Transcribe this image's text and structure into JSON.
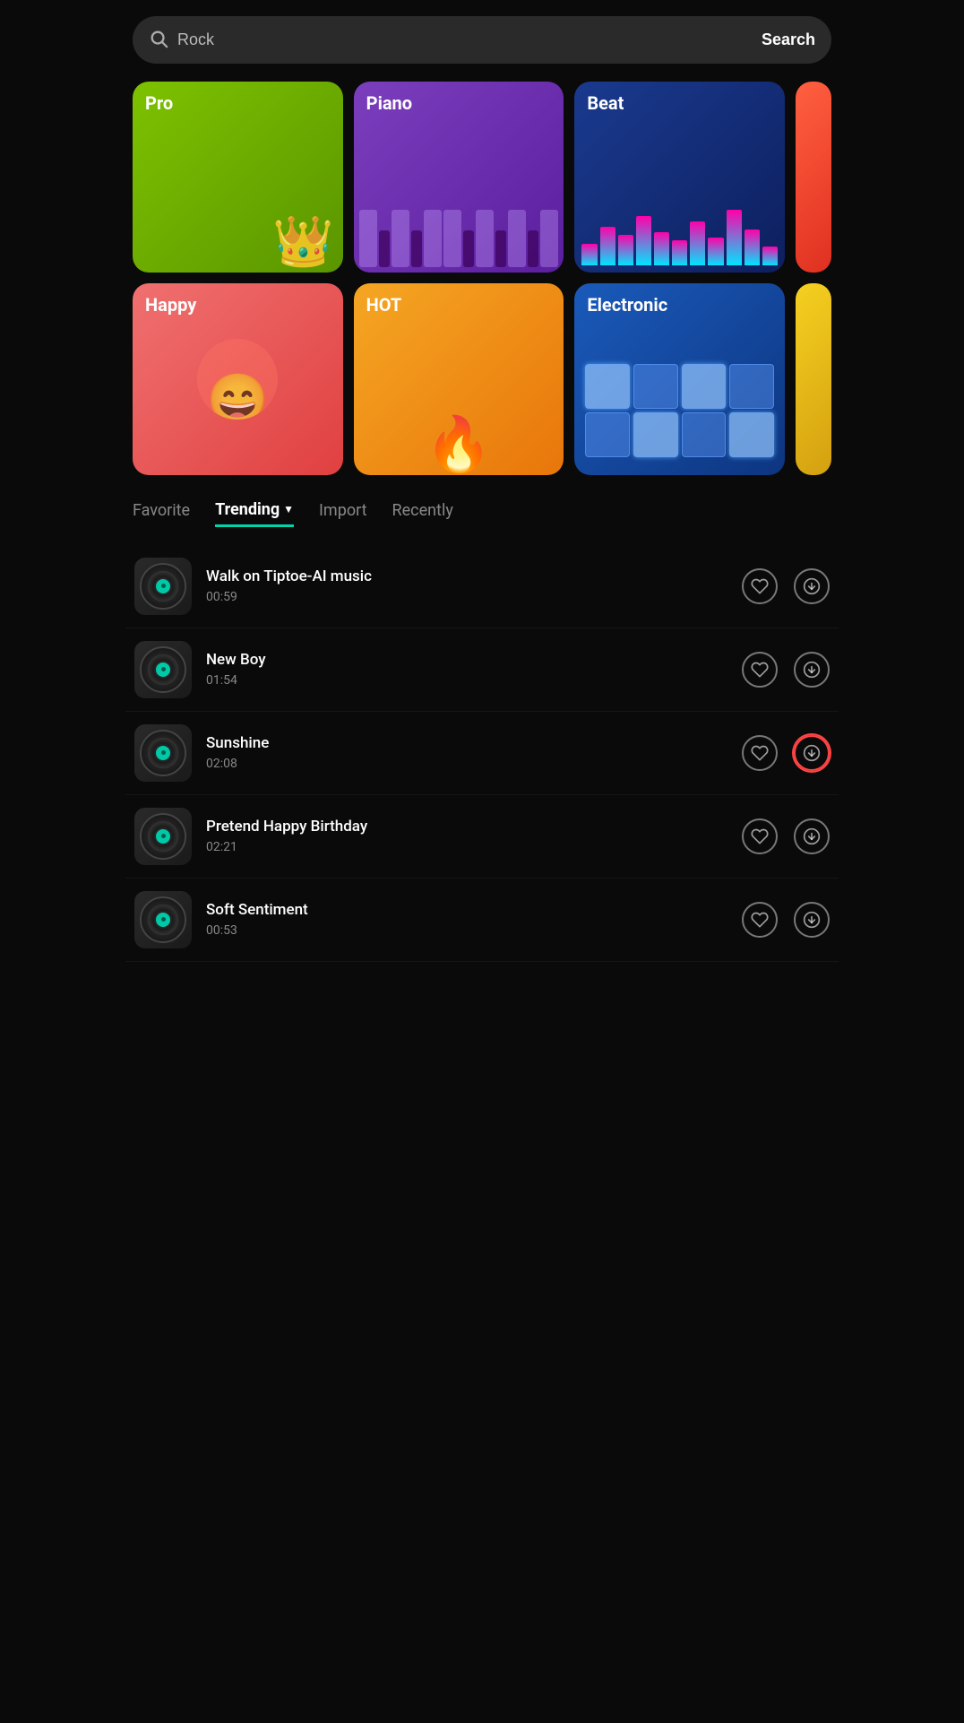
{
  "search": {
    "placeholder": "Rock",
    "button_label": "Search"
  },
  "categories": [
    {
      "id": "pro",
      "label": "Pro",
      "color_start": "#7dc200",
      "color_end": "#5a9500",
      "type": "pro"
    },
    {
      "id": "piano",
      "label": "Piano",
      "color_start": "#7b3fbe",
      "color_end": "#5a1e9e",
      "type": "piano"
    },
    {
      "id": "beat",
      "label": "Beat",
      "color_start": "#1a3a8f",
      "color_end": "#0d1f5e",
      "type": "beat"
    },
    {
      "id": "happy",
      "label": "Happy",
      "color_start": "#f07070",
      "color_end": "#e04040",
      "type": "happy"
    },
    {
      "id": "hot",
      "label": "HOT",
      "color_start": "#f5a623",
      "color_end": "#e8760a",
      "type": "hot"
    },
    {
      "id": "electronic",
      "label": "Electronic",
      "color_start": "#1a5aba",
      "color_end": "#0d3580",
      "type": "electronic"
    }
  ],
  "tabs": [
    {
      "id": "favorite",
      "label": "Favorite",
      "active": false
    },
    {
      "id": "trending",
      "label": "Trending",
      "active": true
    },
    {
      "id": "import",
      "label": "Import",
      "active": false
    },
    {
      "id": "recently",
      "label": "Recently",
      "active": false
    }
  ],
  "tracks": [
    {
      "id": 1,
      "title": "Walk on Tiptoe-AI music",
      "duration": "00:59",
      "highlighted": false
    },
    {
      "id": 2,
      "title": "New Boy",
      "duration": "01:54",
      "highlighted": false
    },
    {
      "id": 3,
      "title": "Sunshine",
      "duration": "02:08",
      "highlighted": true
    },
    {
      "id": 4,
      "title": "Pretend Happy Birthday",
      "duration": "02:21",
      "highlighted": false
    },
    {
      "id": 5,
      "title": "Soft Sentiment",
      "duration": "00:53",
      "highlighted": false
    }
  ],
  "colors": {
    "accent": "#00d4aa",
    "highlight": "#ff4444",
    "bg": "#0a0a0a",
    "card_bg": "#1a1a1a"
  }
}
